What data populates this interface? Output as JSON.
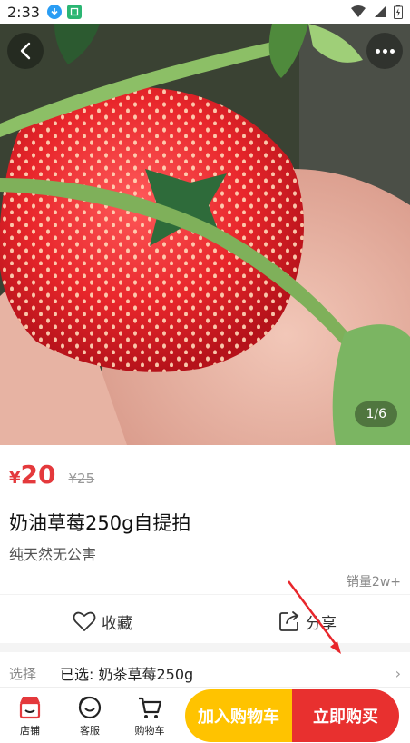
{
  "status_bar": {
    "time": "2:33"
  },
  "gallery": {
    "current": "1",
    "separator": "/",
    "total": "6"
  },
  "product": {
    "currency": "¥",
    "price": "20",
    "original_price": "¥25",
    "title": "奶油草莓250g自提拍",
    "subtitle": "纯天然无公害",
    "sales": "销量2w+"
  },
  "actions": {
    "favorite": "收藏",
    "share": "分享"
  },
  "selection": {
    "label": "选择",
    "value": "已选: 奶茶草莓250g"
  },
  "bottom_bar": {
    "store": "店铺",
    "service": "客服",
    "cart": "购物车",
    "add_to_cart": "加入购物车",
    "buy_now": "立即购买"
  },
  "colors": {
    "price": "#e4393c",
    "add_to_cart": "#ffc300",
    "buy_now": "#e8302f"
  }
}
